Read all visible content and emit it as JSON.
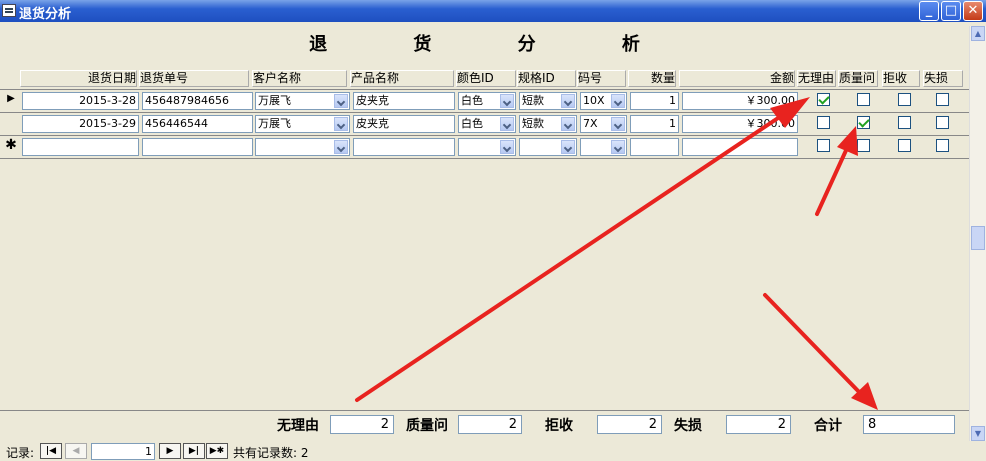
{
  "window": {
    "title": "退货分析"
  },
  "form_title": "退 货 分 析",
  "columns": [
    "退货日期",
    "退货单号",
    "客户名称",
    "产品名称",
    "颜色ID",
    "规格ID",
    "码号",
    "数量",
    "金额",
    "无理由",
    "质量问",
    "拒收",
    "失损"
  ],
  "rows": [
    {
      "date": "2015-3-28",
      "order_no": "456487984656",
      "customer": "万展飞",
      "product": "皮夹克",
      "color": "白色",
      "spec": "短款",
      "size": "10X",
      "qty": "1",
      "amount": "￥300.00",
      "no_reason": true,
      "quality": false,
      "rejected": false,
      "lost": false
    },
    {
      "date": "2015-3-29",
      "order_no": "456446544",
      "customer": "万展飞",
      "product": "皮夹克",
      "color": "白色",
      "spec": "短款",
      "size": "7X",
      "qty": "1",
      "amount": "￥300.00",
      "no_reason": false,
      "quality": true,
      "rejected": false,
      "lost": false
    }
  ],
  "totals": {
    "no_reason_label": "无理由",
    "no_reason": "2",
    "quality_label": "质量问",
    "quality": "2",
    "rejected_label": "拒收",
    "rejected": "2",
    "lost_label": "失损",
    "lost": "2",
    "total_label": "合计",
    "total": "8"
  },
  "nav": {
    "label": "记录:",
    "current": "1",
    "count_text": "共有记录数: 2"
  },
  "colors": {
    "titlebar": "#2a5fd0",
    "form_bg": "#ece9d8",
    "annotation_arrow": "#e8231f",
    "check": "#21a121"
  },
  "icons": {
    "new_record": "asterisk-icon",
    "current_record": "triangle-right-icon"
  }
}
